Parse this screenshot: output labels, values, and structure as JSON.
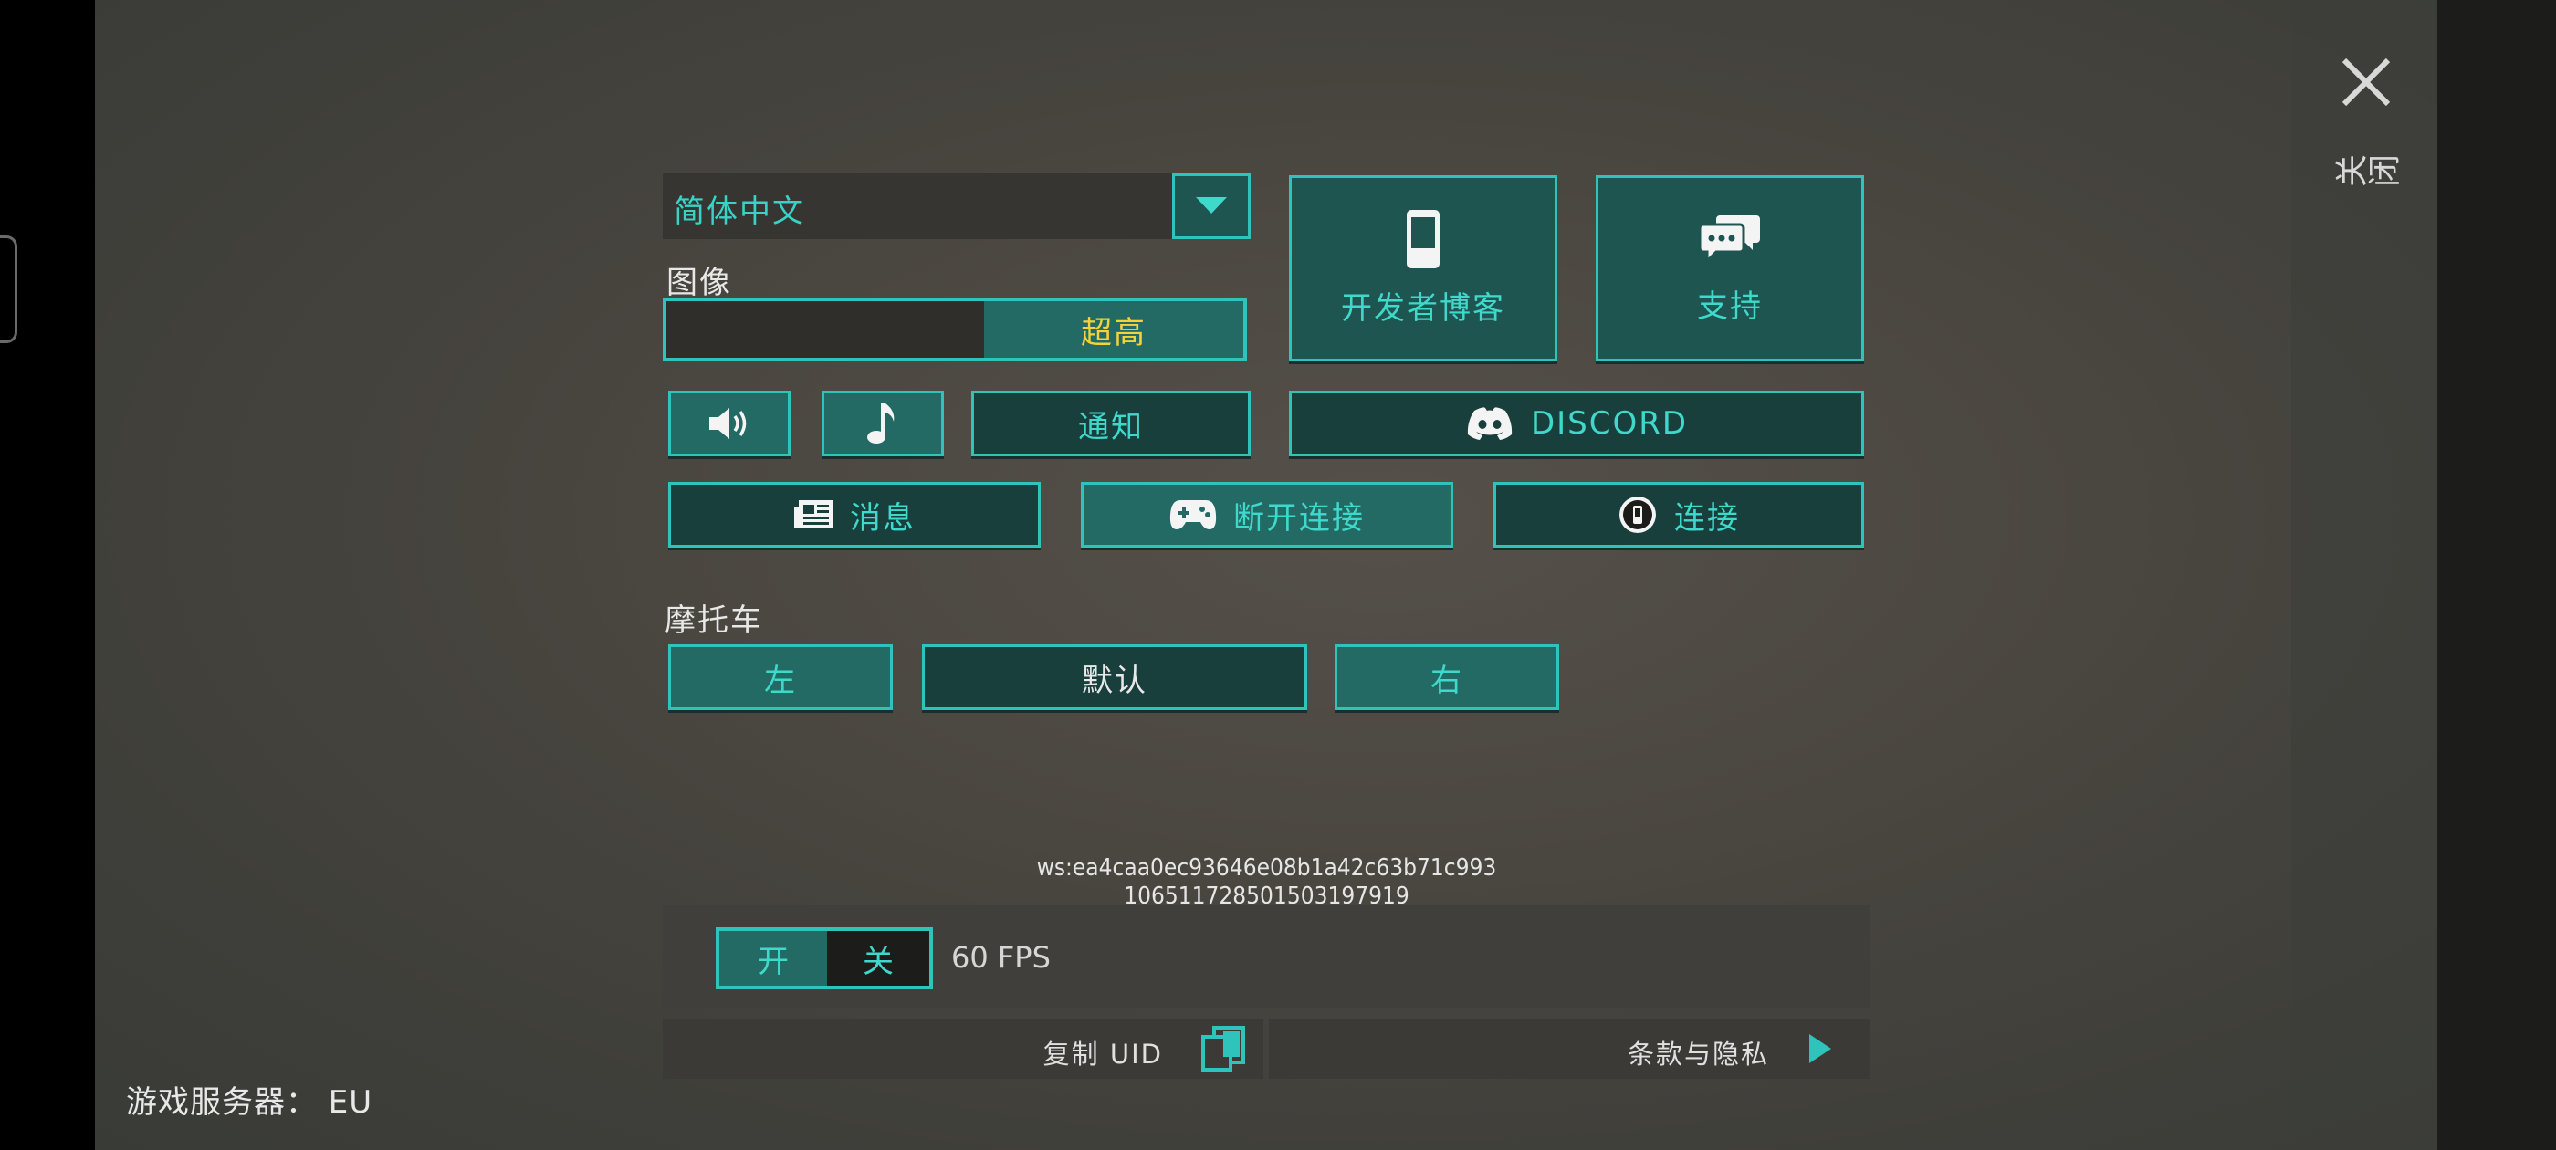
{
  "language": {
    "selected": "简体中文"
  },
  "graphics": {
    "label": "图像",
    "value": "超高",
    "level_fraction": 0.45
  },
  "buttons": {
    "dev_blog": "开发者博客",
    "support": "支持",
    "notify": "通知",
    "discord": "DISCORD",
    "news": "消息",
    "disconnect": "断开连接",
    "connect": "连接"
  },
  "motorbike": {
    "label": "摩托车",
    "left": "左",
    "default": "默认",
    "right": "右"
  },
  "uid": {
    "line1": "ws:ea4caa0ec93646e08b1a42c63b71c993",
    "line2": "106511728501503197919"
  },
  "fps": {
    "on": "开",
    "off": "关",
    "value": "60 FPS"
  },
  "footer": {
    "copy_uid": "复制 UID",
    "terms": "条款与隐私"
  },
  "server": {
    "label": "游戏服务器： EU"
  },
  "close": {
    "label": "关闭"
  },
  "colors": {
    "accent": "#2ec4bb",
    "accent_text": "#3fd9cc",
    "button_bg": "#1f5550",
    "highlight": "#f3d23a"
  }
}
